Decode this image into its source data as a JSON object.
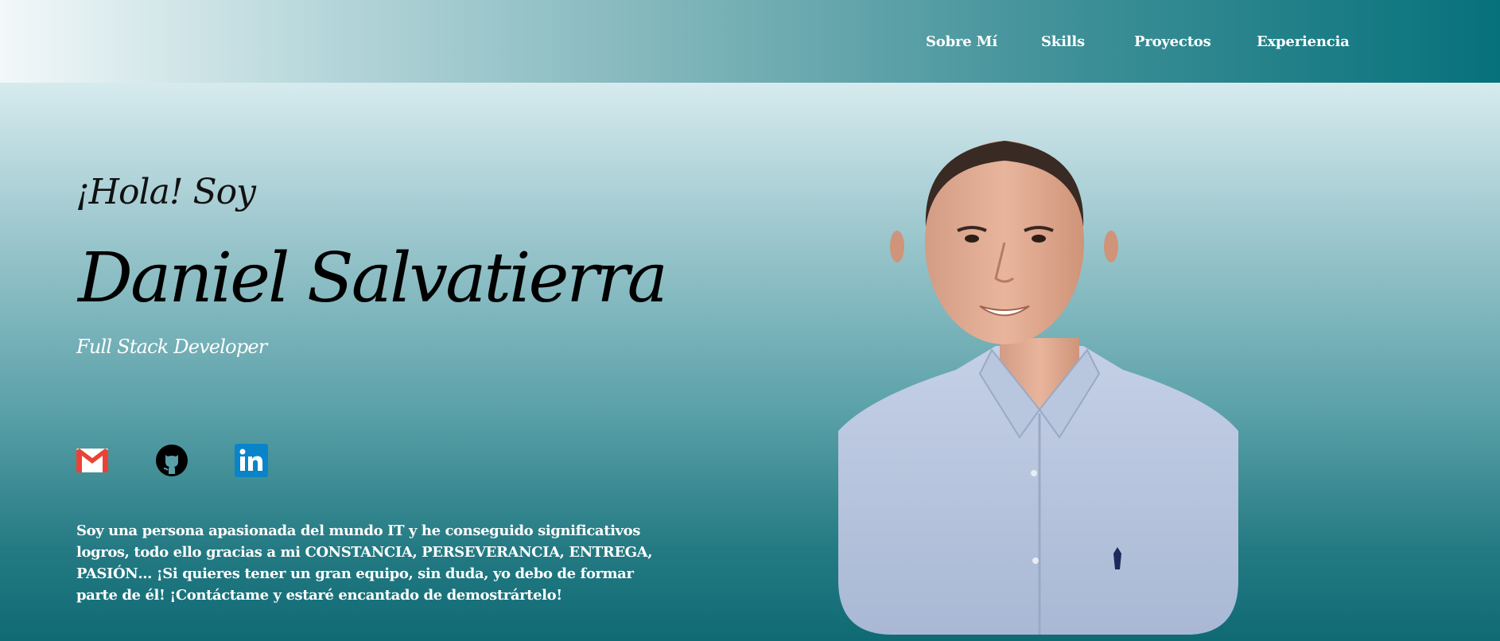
{
  "nav": {
    "items": [
      {
        "label": "Sobre Mí"
      },
      {
        "label": "Skills"
      },
      {
        "label": "Proyectos"
      },
      {
        "label": "Experiencia"
      }
    ]
  },
  "hero": {
    "greeting": "¡Hola! Soy",
    "name": "Daniel Salvatierra",
    "role": "Full Stack Developer"
  },
  "social": {
    "links": [
      {
        "icon": "gmail-icon",
        "color": "#ea4335"
      },
      {
        "icon": "github-icon",
        "color": "#000000"
      },
      {
        "icon": "linkedin-icon",
        "color": "#0a84c8"
      }
    ]
  },
  "about": {
    "text": "Soy una persona apasionada del mundo IT y he conseguido significativos logros, todo ello gracias a mi CONSTANCIA, PERSEVERANCIA, ENTREGA, PASIÓN… ¡Si quieres tener un gran equipo, sin duda, yo debo de formar parte de él! ¡Contáctame y estaré encantado de demostrártelo!"
  },
  "colors": {
    "nav_gradient_start": "#f2f8f9",
    "nav_gradient_end": "#06717b",
    "background_top": "#d6ebee",
    "background_bottom": "#0f6a74",
    "shirt": "#b4c2dc"
  }
}
